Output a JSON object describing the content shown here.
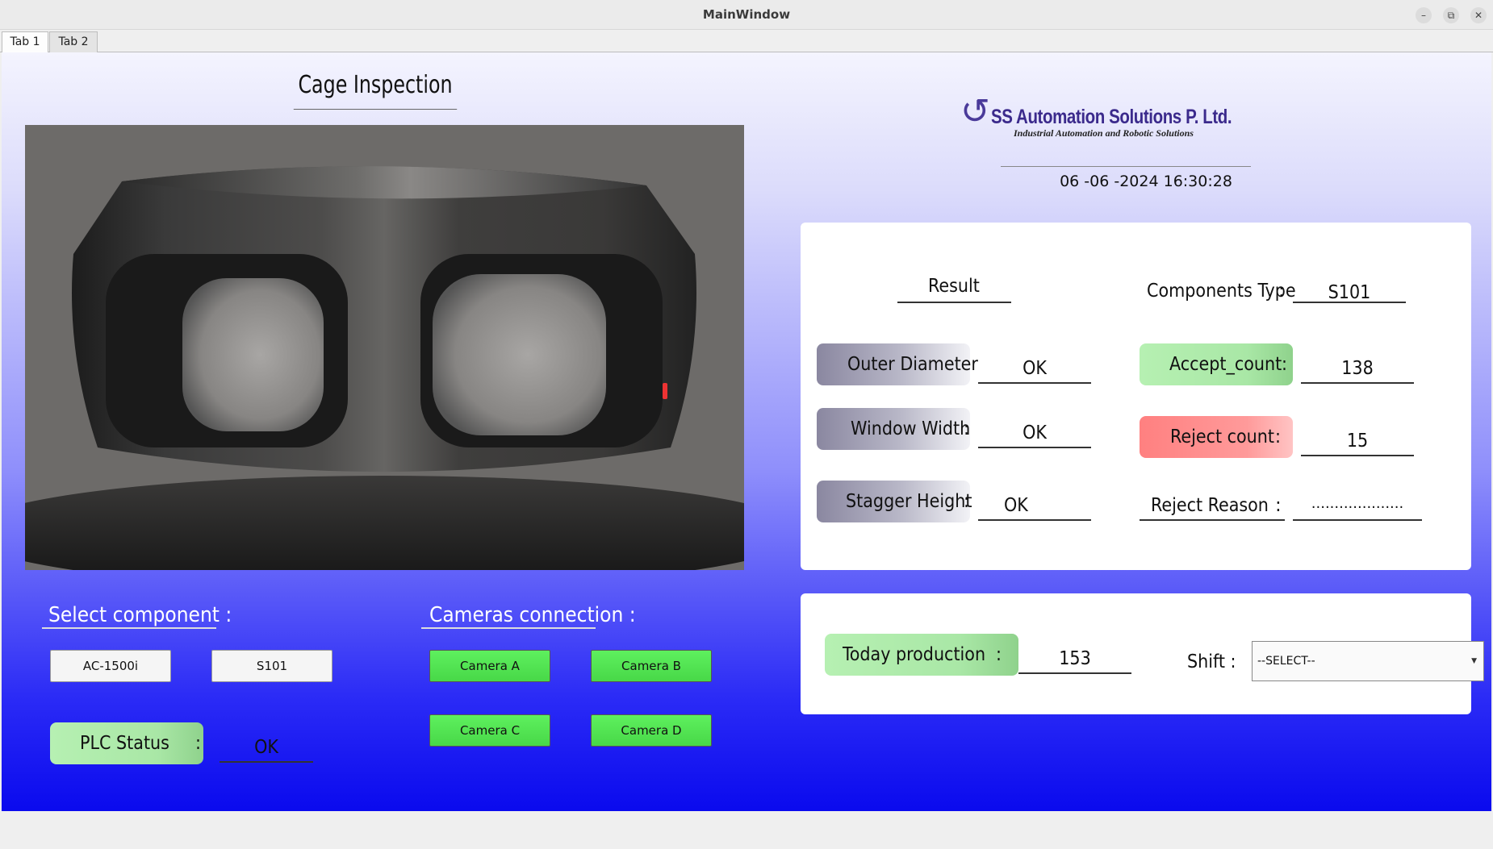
{
  "window": {
    "title": "MainWindow"
  },
  "tabs": [
    {
      "label": "Tab 1"
    },
    {
      "label": "Tab 2"
    }
  ],
  "heading": "Cage Inspection",
  "logo": {
    "company": "SS Automation Solutions P. Ltd.",
    "tagline": "Industrial Automation and Robotic Solutions"
  },
  "datetime": "06 -06 -2024 16:30:28",
  "result": {
    "title": "Result",
    "outer_diameter": {
      "label": "Outer Diameter",
      "value": "OK"
    },
    "window_width": {
      "label": "Window Width",
      "colon": ":",
      "value": "OK"
    },
    "stagger_height": {
      "label": "Stagger Height",
      "colon": ":",
      "value": "OK"
    },
    "components_type": {
      "label": "Components Type",
      "colon": ":",
      "value": "S101"
    },
    "accept_count": {
      "label": "Accept_count",
      "colon": ":",
      "value": "138"
    },
    "reject_count": {
      "label": "Reject count",
      "colon": ":",
      "value": "15"
    },
    "reject_reason": {
      "label": "Reject Reason",
      "colon": ":",
      "value": "...................."
    }
  },
  "production": {
    "today_label": "Today production",
    "colon": ":",
    "today_value": "153",
    "shift_label": "Shift :",
    "shift_selected": "--SELECT--"
  },
  "select_component": {
    "title": "Select component :",
    "buttons": [
      "AC-1500i",
      "S101"
    ]
  },
  "plc": {
    "label": "PLC Status",
    "colon": ":",
    "value": "OK"
  },
  "cameras": {
    "title": "Cameras connection :",
    "buttons": [
      "Camera A",
      "Camera B",
      "Camera C",
      "Camera D"
    ]
  },
  "colors": {
    "accept_green": "#a9e7a6",
    "reject_red": "#ff8a8a",
    "camera_green": "#50e050",
    "panel_blue": "#1212f0"
  }
}
